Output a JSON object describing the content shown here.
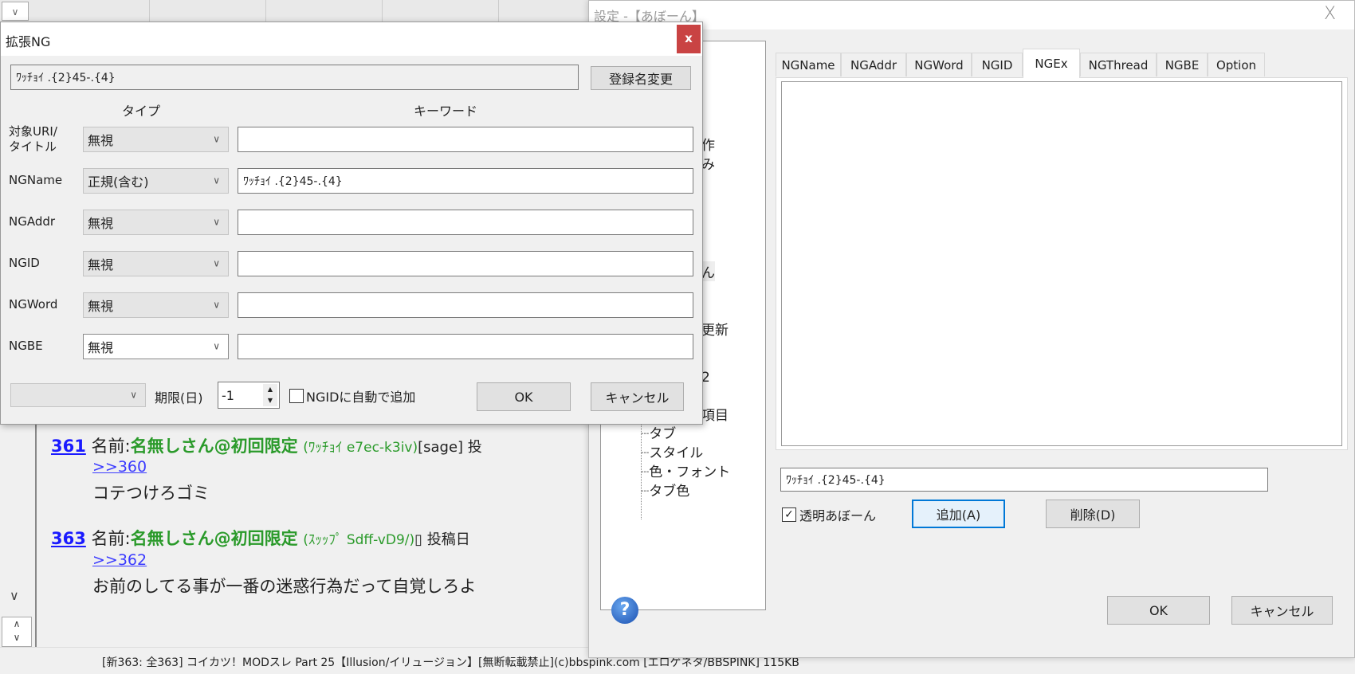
{
  "background": {
    "posts": [
      {
        "number": "361",
        "name_label": "名前:",
        "name": "名無しさん@初回限定",
        "trip": "(ﾜｯﾁｮｲ e7ec-k3iv)",
        "extra": "[sage] 投",
        "anchor": ">>360",
        "body": "コテつけろゴミ"
      },
      {
        "number": "363",
        "name_label": "名前:",
        "name": "名無しさん@初回限定",
        "trip": "(ｽｯｯﾌﾟ Sdff-vD9/)",
        "extra": "▯ 投稿日",
        "anchor": ">>362",
        "body": "お前のしてる事が一番の迷惑行為だって自覚しろよ"
      }
    ],
    "status_bar": "[新363: 全363] コイカツ！MODスレ Part 25【Illusion/イリュージョン】[無断転載禁止](c)bbspink.com [エロゲネタ/BBSPINK] 115KB"
  },
  "settings_dialog": {
    "title": "設定 -【あぼーん】",
    "close": "X",
    "tree_partial": [
      "作",
      "み",
      "ん",
      "更新",
      "2",
      "項目"
    ],
    "tree_items": [
      "タブ",
      "スタイル",
      "色・フォント",
      "タブ色"
    ],
    "tabs": [
      {
        "label": "NGName",
        "active": false
      },
      {
        "label": "NGAddr",
        "active": false
      },
      {
        "label": "NGWord",
        "active": false
      },
      {
        "label": "NGID",
        "active": false
      },
      {
        "label": "NGEx",
        "active": true
      },
      {
        "label": "NGThread",
        "active": false
      },
      {
        "label": "NGBE",
        "active": false
      },
      {
        "label": "Option",
        "active": false
      }
    ],
    "entry_value": "ﾜｯﾁｮｲ .{2}45-.{4}",
    "transparent_label": "透明あぼーん",
    "transparent_checked": true,
    "add_label": "追加(A)",
    "delete_label": "削除(D)",
    "ok_label": "OK",
    "cancel_label": "キャンセル",
    "help_icon": "?"
  },
  "ng_dialog": {
    "title": "拡張NG",
    "close": "x",
    "name_value": "ﾜｯﾁｮｲ .{2}45-.{4}",
    "rename_label": "登録名変更",
    "col_type": "タイプ",
    "col_keyword": "キーワード",
    "rows": [
      {
        "label": "対象URI/\nタイトル",
        "type": "無視",
        "keyword": ""
      },
      {
        "label": "NGName",
        "type": "正規(含む)",
        "keyword": "ﾜｯﾁｮｲ .{2}45-.{4}"
      },
      {
        "label": "NGAddr",
        "type": "無視",
        "keyword": ""
      },
      {
        "label": "NGID",
        "type": "無視",
        "keyword": ""
      },
      {
        "label": "NGWord",
        "type": "無視",
        "keyword": ""
      },
      {
        "label": "NGBE",
        "type": "無視",
        "keyword": ""
      }
    ],
    "bottom_select": "",
    "expiry_label": "期限(日)",
    "expiry_value": "-1",
    "auto_ngid_label": "NGIDに自動で追加",
    "auto_ngid_checked": false,
    "ok_label": "OK",
    "cancel_label": "キャンセル"
  },
  "colors": {
    "close_red": "#c94343",
    "focus_blue": "#0078d7",
    "link_blue": "#1a1aff",
    "name_green": "#2a9a2a"
  }
}
